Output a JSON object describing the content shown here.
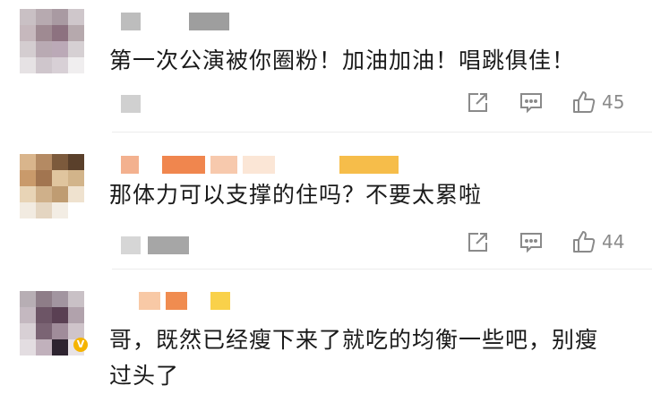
{
  "comments": [
    {
      "text": "第一次公演被你圈粉！加油加油！唱跳俱佳！",
      "likes": "45"
    },
    {
      "text": "那体力可以支撑的住吗？不要太累啦",
      "likes": "44"
    },
    {
      "text": "哥，既然已经瘦下来了就吃的均衡一些吧，别瘦\n过头了",
      "verified_badge": "V"
    }
  ],
  "icons": {
    "share": "share-icon",
    "reply": "comment-icon",
    "like": "thumbs-up-icon"
  },
  "colors": {
    "text": "#1a1a1a",
    "icon": "#8a8a8a",
    "divider": "#ececec",
    "badge": "#f5b400"
  }
}
